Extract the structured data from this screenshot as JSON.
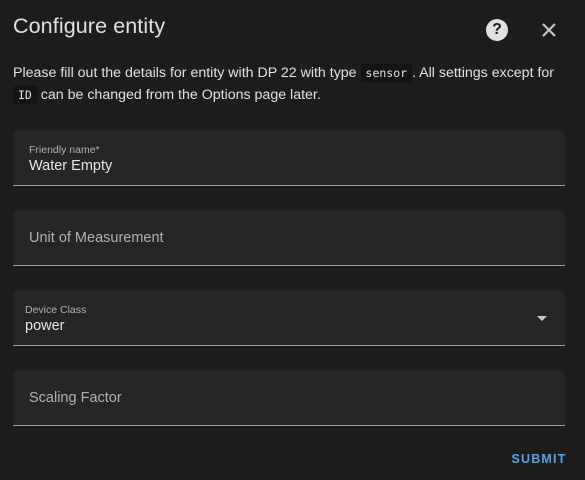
{
  "dialog": {
    "title": "Configure entity",
    "help_icon": "help-circle-icon",
    "close_icon": "close-icon",
    "description": {
      "part1": "Please fill out the details for entity with DP 22 with type ",
      "code1": "sensor",
      "part2": ". All settings except for ",
      "code2": "ID",
      "part3": " can be changed from the Options page later."
    }
  },
  "form": {
    "friendly_name": {
      "label": "Friendly name*",
      "value": "Water Empty"
    },
    "unit_of_measurement": {
      "label": "Unit of Measurement",
      "value": ""
    },
    "device_class": {
      "label": "Device Class",
      "value": "power",
      "icon": "dropdown-arrow-icon"
    },
    "scaling_factor": {
      "label": "Scaling Factor",
      "value": ""
    }
  },
  "actions": {
    "submit_label": "SUBMIT"
  }
}
